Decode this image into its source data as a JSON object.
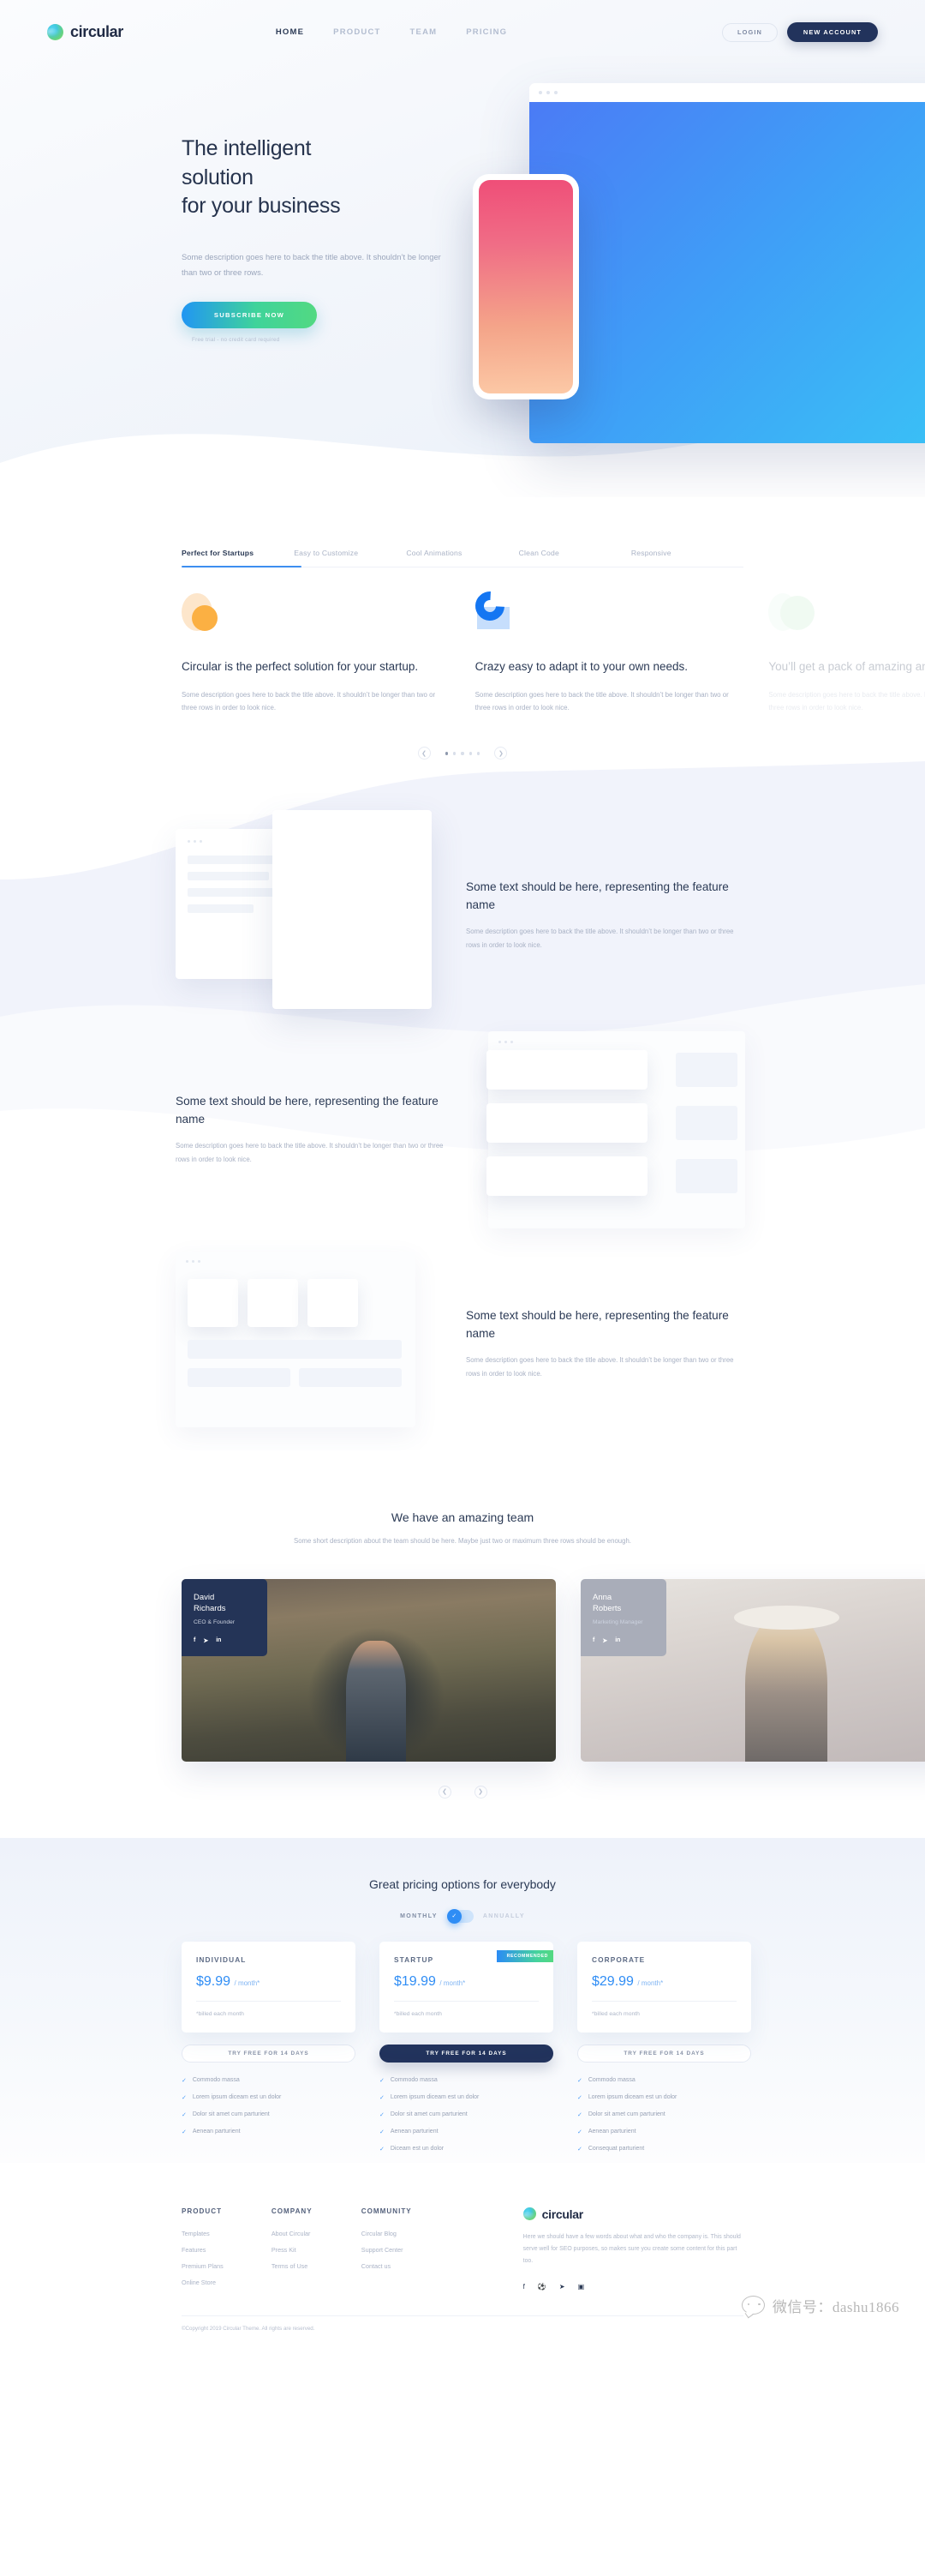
{
  "brand": {
    "name": "circular",
    "logo_icon": "globe-gradient-icon"
  },
  "nav": {
    "items": [
      {
        "label": "HOME",
        "active": true
      },
      {
        "label": "PRODUCT",
        "active": false
      },
      {
        "label": "TEAM",
        "active": false
      },
      {
        "label": "PRICING",
        "active": false
      }
    ],
    "login_label": "LOGIN",
    "account_label": "NEW ACCOUNT"
  },
  "hero": {
    "title_line1": "The intelligent solution",
    "title_line2": "for your business",
    "description": "Some description goes here to back the title above. It shouldn’t be longer than two or three rows.",
    "cta_label": "SUBSCRIBE NOW",
    "note": "Free trial - no credit card required"
  },
  "tabs": [
    {
      "label": "Perfect for Startups",
      "active": true
    },
    {
      "label": "Easy to Customize",
      "active": false
    },
    {
      "label": "Cool Animations",
      "active": false
    },
    {
      "label": "Clean Code",
      "active": false
    },
    {
      "label": "Responsive",
      "active": false
    }
  ],
  "feature_cards": [
    {
      "icon": "orange-circle-blob-icon",
      "title": "Circular is the perfect solution for your startup.",
      "desc": "Some description goes here to back the title above. It shouldn’t be longer than two or three rows in order to look nice."
    },
    {
      "icon": "blue-arc-blob-icon",
      "title": "Crazy easy to adapt it to your own needs.",
      "desc": "Some description goes here to back the title above. It shouldn’t be longer than two or three rows in order to look nice."
    },
    {
      "icon": "green-circle-blob-icon",
      "title": "You’ll get a pack of amazing animations",
      "desc": "Some description goes here to back the title above. It shouldn’t be longer than two or three rows in order to look nice."
    }
  ],
  "carousel": {
    "prev_icon": "chevron-left-icon",
    "next_icon": "chevron-right-icon",
    "dots": 5,
    "active_dot": 1
  },
  "feature_rows": [
    {
      "title": "Some text should be here, representing the feature name",
      "desc": "Some description goes here to back the title above. It shouldn’t be longer than two or three rows in order to look nice.",
      "mock": "window-overlap-mock"
    },
    {
      "title": "Some text should be here, representing the feature name",
      "desc": "Some description goes here to back the title above. It shouldn’t be longer than two or three rows in order to look nice.",
      "mock": "list-panel-mock"
    },
    {
      "title": "Some text should be here, representing the feature name",
      "desc": "Some description goes here to back the title above. It shouldn’t be longer than two or three rows in order to look nice.",
      "mock": "tiles-panel-mock"
    }
  ],
  "team": {
    "title": "We have an amazing team",
    "subtitle": "Some short description about the team should be here. Maybe just two or maximum three rows should be enough.",
    "members": [
      {
        "name_line1": "David",
        "name_line2": "Richards",
        "role": "CEO & Founder",
        "socials": [
          "facebook-icon",
          "twitter-icon",
          "linkedin-icon"
        ]
      },
      {
        "name_line1": "Anna",
        "name_line2": "Roberts",
        "role": "Marketing Manager",
        "socials": [
          "facebook-icon",
          "twitter-icon",
          "linkedin-icon"
        ]
      }
    ],
    "prev_icon": "chevron-left-icon",
    "next_icon": "chevron-right-icon"
  },
  "pricing": {
    "title": "Great pricing options for everybody",
    "toggle_monthly": "MONTHLY",
    "toggle_annually": "ANNUALLY",
    "toggle_selected": "MONTHLY",
    "toggle_knob_icon": "check-icon",
    "ribbon_label": "RECOMMENDED",
    "accent_blue": "#2f8df5",
    "accent_dark": "#22335c",
    "plans": [
      {
        "name": "INDIVIDUAL",
        "price": "$9.99",
        "period": "/ month*",
        "billed": "*billed each month",
        "cta": "TRY FREE FOR 14 DAYS",
        "highlighted": false,
        "recommended": false,
        "features": [
          "Commodo massa",
          "Lorem ipsum diceam est un dolor",
          "Dolor sit amet cum parturient",
          "Aenean parturient"
        ]
      },
      {
        "name": "STARTUP",
        "price": "$19.99",
        "period": "/ month*",
        "billed": "*billed each month",
        "cta": "TRY FREE FOR 14 DAYS",
        "highlighted": true,
        "recommended": true,
        "features": [
          "Commodo massa",
          "Lorem ipsum diceam est un dolor",
          "Dolor sit amet cum parturient",
          "Aenean parturient",
          "Diceam est un dolor"
        ]
      },
      {
        "name": "CORPORATE",
        "price": "$29.99",
        "period": "/ month*",
        "billed": "*billed each month",
        "cta": "TRY FREE FOR 14 DAYS",
        "highlighted": false,
        "recommended": false,
        "features": [
          "Commodo massa",
          "Lorem ipsum diceam est un dolor",
          "Dolor sit amet cum parturient",
          "Aenean parturient",
          "Consequat parturient"
        ]
      }
    ]
  },
  "footer": {
    "columns": [
      {
        "heading": "PRODUCT",
        "links": [
          "Templates",
          "Features",
          "Premium Plans",
          "Online Store"
        ]
      },
      {
        "heading": "COMPANY",
        "links": [
          "About Circular",
          "Press Kit",
          "Terms of Use"
        ]
      },
      {
        "heading": "COMMUNITY",
        "links": [
          "Circular Blog",
          "Support Center",
          "Contact us"
        ]
      }
    ],
    "brand_name": "circular",
    "about": "Here we should have a few words about what and who the company is. This should serve well for SEO purposes, so makes sure you create some content for this part too.",
    "socials": [
      "facebook-icon",
      "dribbble-icon",
      "twitter-icon",
      "instagram-icon"
    ],
    "copyright": "©Copyright 2019 Circular Theme. All rights are reserved."
  },
  "watermark": {
    "text": "微信号：dashu1866",
    "icon": "wechat-icon"
  }
}
